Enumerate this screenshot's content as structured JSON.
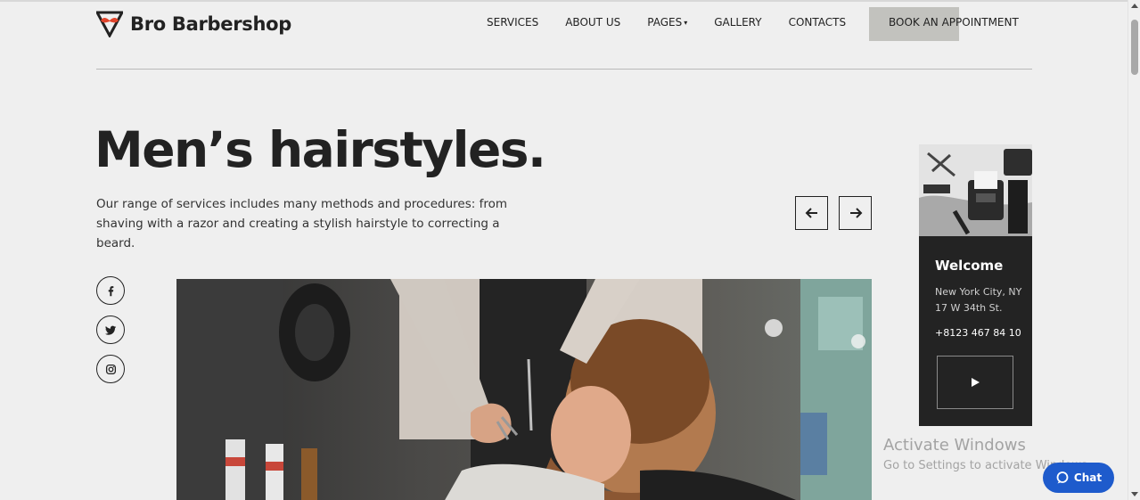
{
  "brand": {
    "name": "Bro Barbershop",
    "accent": "#e0452c"
  },
  "nav": {
    "items": [
      "SERVICES",
      "ABOUT US",
      "PAGES",
      "GALLERY",
      "CONTACTS"
    ],
    "pages_caret": "▾",
    "cta": "BOOK AN APPOINTMENT"
  },
  "hero": {
    "title": "Men’s hairstyles.",
    "description": "Our range of services includes many methods and procedures: from shaving with a razor and creating a stylish hairstyle to correcting a beard."
  },
  "slider": {
    "prev_icon": "arrow-left-icon",
    "next_icon": "arrow-right-icon"
  },
  "social": [
    "facebook-icon",
    "twitter-icon",
    "instagram-icon"
  ],
  "sidebar": {
    "title": "Welcome",
    "address": "New York City, NY 17 W 34th St.",
    "phone": "+8123 467 84 10",
    "play_icon": "play-icon"
  },
  "watermark": {
    "line1": "Activate Windows",
    "line2": "Go to Settings to activate Windows."
  },
  "chat": {
    "label": "Chat",
    "color": "#1e5bcc"
  }
}
